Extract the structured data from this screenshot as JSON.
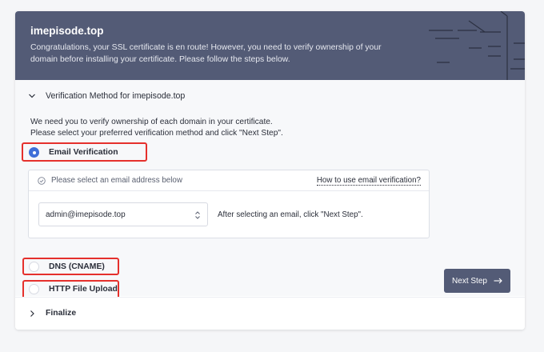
{
  "banner": {
    "title": "imepisode.top",
    "text": "Congratulations, your SSL certificate is en route! However, you need to verify ownership of your domain before installing your certificate. Please follow the steps below."
  },
  "verification": {
    "section_title": "Verification Method for imepisode.top",
    "intro_line1": "We need you to verify ownership of each domain in your certificate.",
    "intro_line2": "Please select your preferred verification method and click \"Next Step\".",
    "options": [
      {
        "label": "Email Verification",
        "selected": true
      },
      {
        "label": "DNS (CNAME)",
        "selected": false
      },
      {
        "label": "HTTP File Upload",
        "selected": false
      }
    ],
    "email_panel": {
      "header_label": "Please select an email address below",
      "help_link": "How to use email verification?",
      "selected_email": "admin@imepisode.top",
      "hint": "After selecting an email, click \"Next Step\"."
    },
    "next_button": "Next Step"
  },
  "finalize": {
    "title": "Finalize"
  },
  "colors": {
    "banner": "#535b76",
    "accent": "#3f6fd8",
    "highlight": "#e5302c"
  }
}
